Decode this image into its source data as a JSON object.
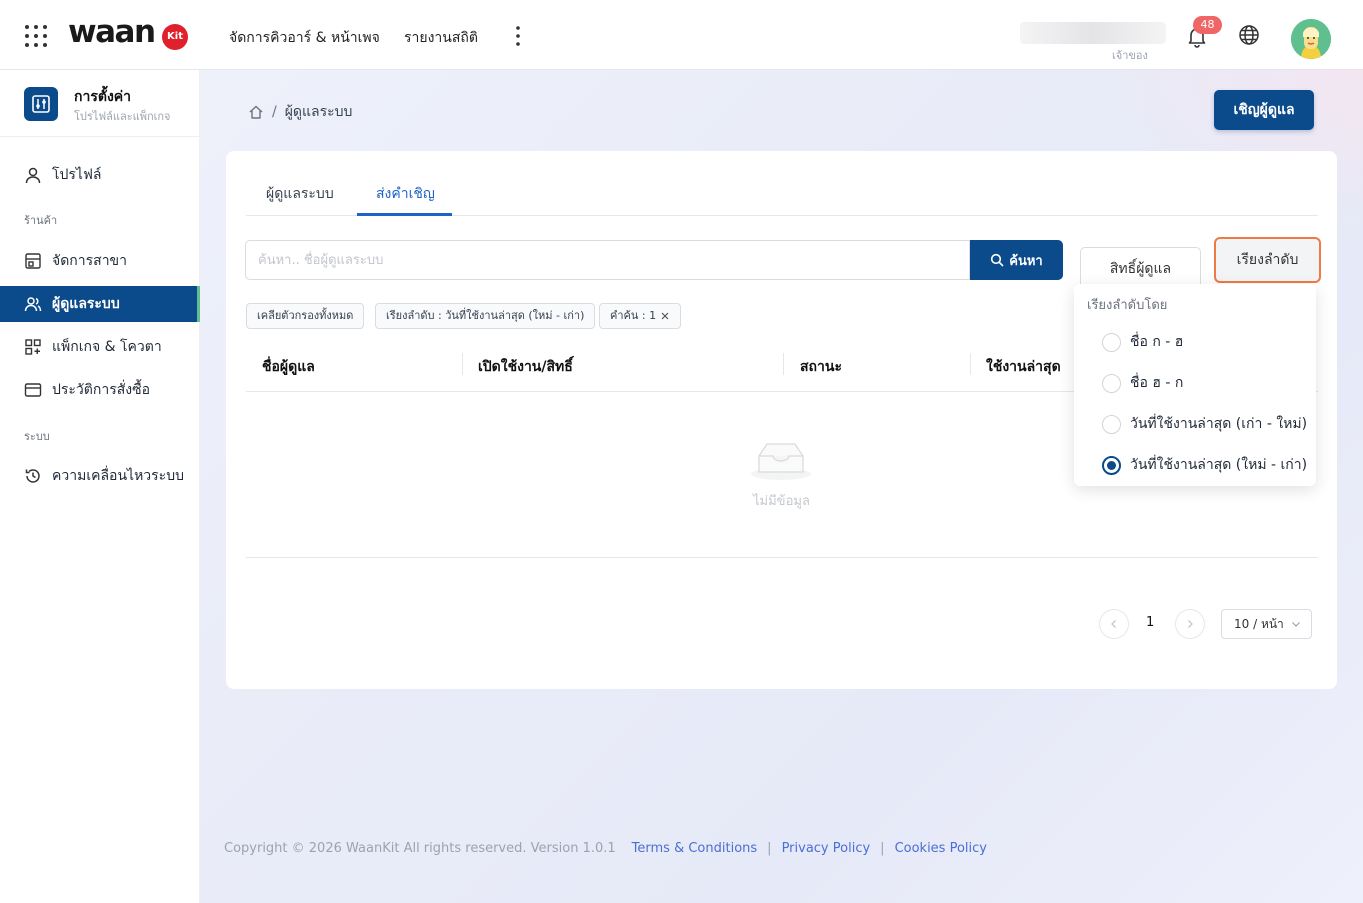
{
  "app": {
    "logo_text": "waan",
    "logo_badge": "Kit"
  },
  "topnav": {
    "items": [
      "จัดการคิวอาร์ & หน้าเพจ",
      "รายงานสถิติ"
    ]
  },
  "user": {
    "role": "เจ้าของ",
    "notification_count": "48"
  },
  "sidebar": {
    "header_title": "การตั้งค่า",
    "header_subtitle": "โปรไฟล์และแพ็กเกจ",
    "profile_label": "โปรไฟล์",
    "group_store": "ร้านค้า",
    "items_store": [
      {
        "label": "จัดการสาขา",
        "icon": "store-icon"
      },
      {
        "label": "ผู้ดูแลระบบ",
        "icon": "users-icon",
        "active": true
      },
      {
        "label": "แพ็กเกจ & โควตา",
        "icon": "grid-icon"
      },
      {
        "label": "ประวัติการสั่งซื้อ",
        "icon": "card-icon"
      }
    ],
    "group_system": "ระบบ",
    "items_system": [
      {
        "label": "ความเคลื่อนไหวระบบ",
        "icon": "history-icon"
      }
    ]
  },
  "breadcrumb": {
    "current": "ผู้ดูแลระบบ"
  },
  "invite_button": "เชิญผู้ดูแล",
  "tabs": [
    {
      "label": "ผู้ดูแลระบบ",
      "active": false
    },
    {
      "label": "ส่งคำเชิญ",
      "active": true
    }
  ],
  "search": {
    "placeholder": "ค้นหา.. ชื่อผู้ดูแลระบบ",
    "button": "ค้นหา"
  },
  "filters": {
    "permission_button": "สิทธิ์ผู้ดูแล",
    "sort_button": "เรียงลำดับ"
  },
  "chips": {
    "clear_all": "เคลียตัวกรองทั้งหมด",
    "sort": "เรียงลำดับ : วันที่ใช้งานล่าสุด (ใหม่ - เก่า)",
    "keyword": "คำค้น : 1"
  },
  "table": {
    "columns": [
      "ชื่อผู้ดูแล",
      "เปิดใช้งาน/สิทธิ์",
      "สถานะ",
      "ใช้งานล่าสุด"
    ],
    "empty_text": "ไม่มีข้อมูล"
  },
  "pagination": {
    "current_page": "1",
    "page_size": "10 / หน้า"
  },
  "sort_dropdown": {
    "title": "เรียงลำดับโดย",
    "options": [
      {
        "label": "ชื่อ ก - ฮ",
        "selected": false
      },
      {
        "label": "ชื่อ ฮ - ก",
        "selected": false
      },
      {
        "label": "วันที่ใช้งานล่าสุด (เก่า - ใหม่)",
        "selected": false
      },
      {
        "label": "วันที่ใช้งานล่าสุด (ใหม่ - เก่า)",
        "selected": true
      }
    ]
  },
  "footer": {
    "copyright": "Copyright © 2026 WaanKit All rights reserved. Version 1.0.1",
    "links": [
      "Terms & Conditions",
      "Privacy Policy",
      "Cookies Policy"
    ],
    "separator": "|"
  },
  "colors": {
    "primary": "#0b4a8b",
    "accent_tab": "#1e63c6",
    "sort_outline": "#f07a43",
    "badge_red": "#f06565"
  }
}
